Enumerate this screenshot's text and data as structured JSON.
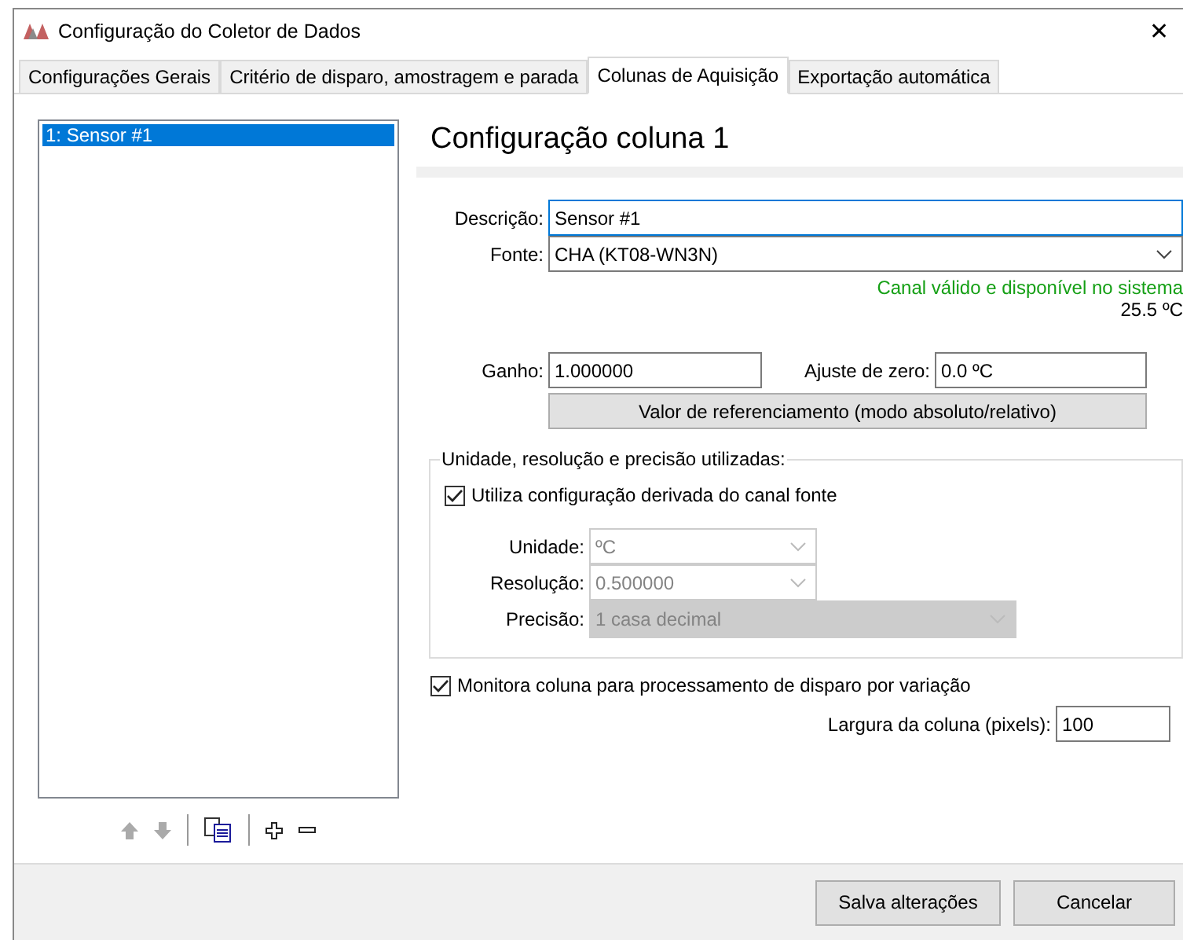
{
  "window": {
    "title": "Configuração do Coletor de Dados",
    "close": "✕"
  },
  "tabs": [
    {
      "label": "Configurações Gerais",
      "selected": false
    },
    {
      "label": "Critério de disparo, amostragem e parada",
      "selected": false
    },
    {
      "label": "Colunas de Aquisição",
      "selected": true
    },
    {
      "label": "Exportação automática",
      "selected": false
    }
  ],
  "columns_list": {
    "items": [
      {
        "label": "1: Sensor #1",
        "selected": true
      }
    ]
  },
  "panel": {
    "heading": "Configuração coluna 1",
    "description": {
      "label": "Descrição:",
      "value": "Sensor #1"
    },
    "source": {
      "label": "Fonte:",
      "value": "CHA (KT08-WN3N)"
    },
    "status_text": "Canal válido e disponível no sistema",
    "reading": "25.5 ºC",
    "gain": {
      "label": "Ganho:",
      "value": "1.000000"
    },
    "zero_offset": {
      "label": "Ajuste de zero:",
      "value": "0.0 ºC"
    },
    "reference_button": "Valor de referenciamento (modo absoluto/relativo)",
    "unit_group": {
      "legend": "Unidade, resolução e precisão utilizadas:",
      "use_derived": {
        "label": "Utiliza configuração derivada do canal fonte",
        "checked": true
      },
      "selects": [
        {
          "label": "Unidade:",
          "value": "ºC",
          "kind": "combo",
          "disabled": true
        },
        {
          "label": "Resolução:",
          "value": "0.500000",
          "kind": "combo",
          "disabled": true
        },
        {
          "label": "Precisão:",
          "value": "1 casa decimal",
          "kind": "list",
          "disabled": true
        }
      ]
    },
    "monitor": {
      "label": "Monitora coluna para processamento de disparo por variação",
      "checked": true
    },
    "column_width": {
      "label": "Largura da coluna (pixels):",
      "value": "100"
    }
  },
  "buttons": [
    "Salva alterações",
    "Cancelar"
  ]
}
